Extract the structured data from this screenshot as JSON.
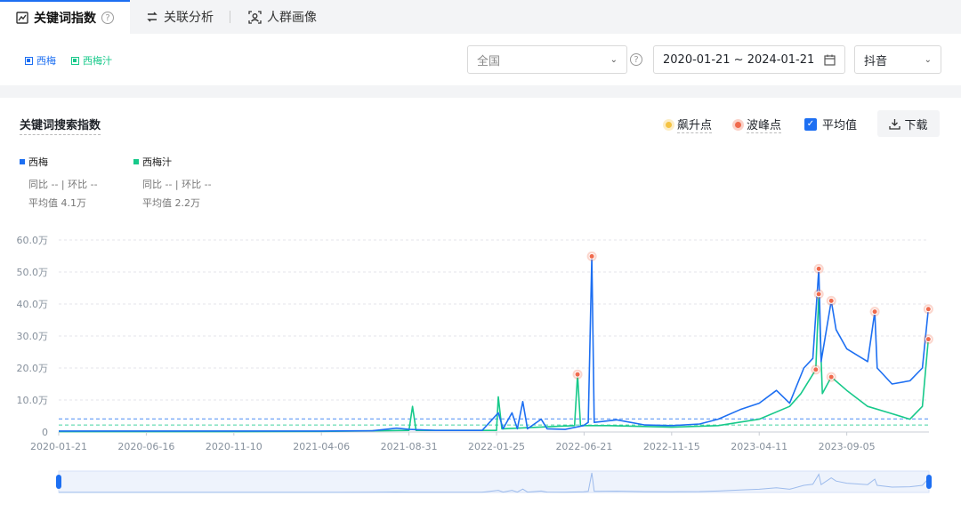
{
  "tabs": [
    {
      "label": "关键词指数",
      "active": true
    },
    {
      "label": "关联分析",
      "active": false
    },
    {
      "label": "人群画像",
      "active": false
    }
  ],
  "keywords": [
    {
      "label": "西梅",
      "color": "#1d6ff2"
    },
    {
      "label": "西梅汁",
      "color": "#17c98a"
    }
  ],
  "filters": {
    "region": "全国",
    "date_range": "2020-01-21 ~ 2024-01-21",
    "platform": "抖音"
  },
  "card": {
    "title": "关键词搜索指数",
    "legend_surge": "飙升点",
    "legend_peak": "波峰点",
    "legend_avg": "平均值",
    "download": "下载"
  },
  "series_info": [
    {
      "name": "西梅",
      "yoy": "同比 -- | 环比 --",
      "avg": "平均值 4.1万"
    },
    {
      "name": "西梅汁",
      "yoy": "同比 -- | 环比 --",
      "avg": "平均值 2.2万"
    }
  ],
  "chart_data": {
    "type": "line",
    "title": "关键词搜索指数",
    "xlabel": "",
    "ylabel": "",
    "x_range": [
      "2020-01-21",
      "2024-01-21"
    ],
    "x_ticks": [
      "2020-01-21",
      "2020-06-16",
      "2020-11-10",
      "2021-04-06",
      "2021-08-31",
      "2022-01-25",
      "2022-06-21",
      "2022-11-15",
      "2023-04-11",
      "2023-09-05"
    ],
    "y_ticks": [
      "0",
      "10.0万",
      "20.0万",
      "30.0万",
      "40.0万",
      "50.0万",
      "60.0万"
    ],
    "ylim": [
      0,
      600000
    ],
    "grid": true,
    "series": [
      {
        "name": "西梅",
        "color": "#1d6ff2",
        "average": 41000,
        "points": [
          [
            "2020-01-21",
            3000
          ],
          [
            "2020-06-16",
            3000
          ],
          [
            "2020-11-10",
            3000
          ],
          [
            "2021-04-06",
            3000
          ],
          [
            "2021-07-01",
            4000
          ],
          [
            "2021-08-10",
            12000
          ],
          [
            "2021-09-01",
            8000
          ],
          [
            "2021-10-15",
            5000
          ],
          [
            "2022-01-01",
            5000
          ],
          [
            "2022-01-28",
            60000
          ],
          [
            "2022-02-05",
            10000
          ],
          [
            "2022-02-20",
            60000
          ],
          [
            "2022-03-01",
            10000
          ],
          [
            "2022-03-10",
            95000
          ],
          [
            "2022-03-18",
            10000
          ],
          [
            "2022-04-10",
            40000
          ],
          [
            "2022-04-20",
            10000
          ],
          [
            "2022-05-20",
            8000
          ],
          [
            "2022-06-20",
            20000
          ],
          [
            "2022-06-28",
            30000
          ],
          [
            "2022-07-04",
            549000
          ],
          [
            "2022-07-08",
            30000
          ],
          [
            "2022-08-15",
            38000
          ],
          [
            "2022-10-01",
            22000
          ],
          [
            "2022-11-15",
            20000
          ],
          [
            "2023-01-01",
            25000
          ],
          [
            "2023-02-01",
            40000
          ],
          [
            "2023-03-10",
            70000
          ],
          [
            "2023-04-11",
            90000
          ],
          [
            "2023-05-10",
            130000
          ],
          [
            "2023-06-01",
            90000
          ],
          [
            "2023-06-25",
            200000
          ],
          [
            "2023-07-10",
            230000
          ],
          [
            "2023-07-20",
            510000
          ],
          [
            "2023-07-24",
            220000
          ],
          [
            "2023-08-10",
            410000
          ],
          [
            "2023-08-18",
            320000
          ],
          [
            "2023-09-05",
            260000
          ],
          [
            "2023-10-10",
            220000
          ],
          [
            "2023-10-22",
            376000
          ],
          [
            "2023-10-26",
            200000
          ],
          [
            "2023-11-20",
            150000
          ],
          [
            "2023-12-20",
            160000
          ],
          [
            "2024-01-10",
            200000
          ],
          [
            "2024-01-20",
            384000
          ]
        ]
      },
      {
        "name": "西梅汁",
        "color": "#17c98a",
        "average": 22000,
        "points": [
          [
            "2020-01-21",
            1000
          ],
          [
            "2020-06-16",
            1000
          ],
          [
            "2020-11-10",
            1000
          ],
          [
            "2021-04-06",
            2000
          ],
          [
            "2021-08-31",
            5000
          ],
          [
            "2021-09-06",
            80000
          ],
          [
            "2021-09-12",
            5000
          ],
          [
            "2022-01-25",
            5000
          ],
          [
            "2022-01-28",
            110000
          ],
          [
            "2022-02-03",
            10000
          ],
          [
            "2022-06-05",
            20000
          ],
          [
            "2022-06-10",
            180000
          ],
          [
            "2022-06-15",
            20000
          ],
          [
            "2022-08-01",
            20000
          ],
          [
            "2022-11-15",
            15000
          ],
          [
            "2023-02-01",
            20000
          ],
          [
            "2023-04-11",
            40000
          ],
          [
            "2023-06-01",
            80000
          ],
          [
            "2023-06-20",
            120000
          ],
          [
            "2023-07-15",
            195000
          ],
          [
            "2023-07-20",
            431000
          ],
          [
            "2023-07-26",
            120000
          ],
          [
            "2023-08-10",
            172000
          ],
          [
            "2023-09-05",
            130000
          ],
          [
            "2023-10-10",
            80000
          ],
          [
            "2023-11-15",
            60000
          ],
          [
            "2023-12-20",
            40000
          ],
          [
            "2024-01-10",
            80000
          ],
          [
            "2024-01-20",
            290000
          ]
        ]
      }
    ],
    "peak_points": [
      [
        "2022-06-10",
        180000
      ],
      [
        "2022-07-04",
        549000
      ],
      [
        "2023-07-15",
        195000
      ],
      [
        "2023-07-20",
        510000
      ],
      [
        "2023-07-20",
        431000
      ],
      [
        "2023-08-10",
        410000
      ],
      [
        "2023-08-10",
        172000
      ],
      [
        "2023-10-22",
        376000
      ],
      [
        "2024-01-20",
        384000
      ],
      [
        "2024-01-20",
        290000
      ]
    ]
  }
}
